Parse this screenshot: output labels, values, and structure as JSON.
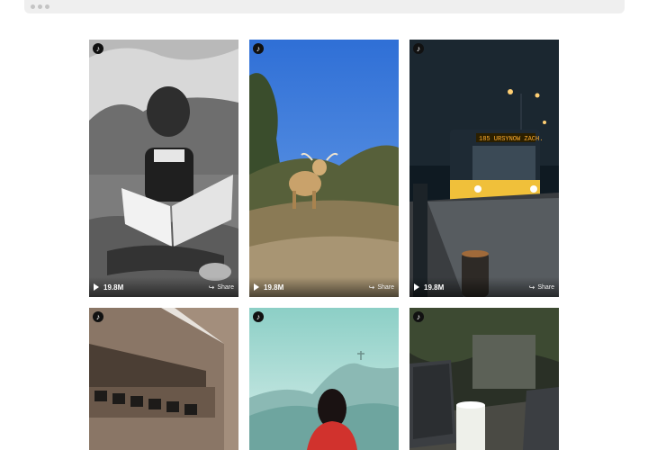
{
  "window": {
    "title_dots": [
      "dot",
      "dot",
      "dot"
    ]
  },
  "grid": {
    "videos": [
      {
        "subject": "child reading a book in grass (black and white)",
        "views": "19.8M",
        "share_label": "Share"
      },
      {
        "subject": "highland cow on a hillside under blue sky",
        "views": "19.8M",
        "share_label": "Share"
      },
      {
        "subject": "city bus at night on wet street",
        "views": "19.8M",
        "share_label": "Share"
      },
      {
        "subject": "concrete building facade",
        "views": "",
        "share_label": ""
      },
      {
        "subject": "person in red on misty mountain view",
        "views": "",
        "share_label": ""
      },
      {
        "subject": "glass of milk beside laptops",
        "views": "",
        "share_label": ""
      }
    ],
    "platform_icon": "tiktok-icon",
    "bus_sign": "185 URSYNOW ZACH."
  }
}
